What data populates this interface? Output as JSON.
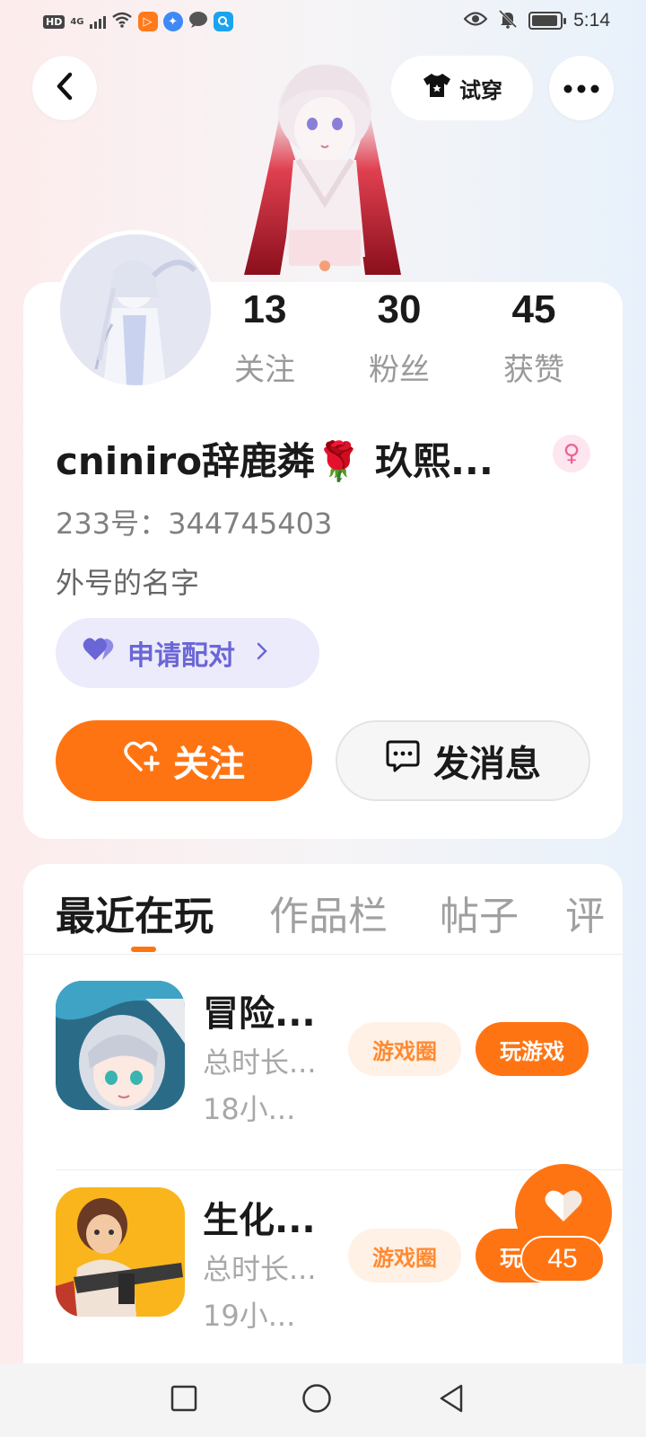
{
  "status_bar": {
    "hd": "HD",
    "network": "4G",
    "time": "5:14"
  },
  "header": {
    "back_icon": "chevron-left-icon",
    "try_on_label": "试穿",
    "try_on_icon": "shirt-icon",
    "more_icon": "more-dots-icon"
  },
  "profile": {
    "stats": [
      {
        "value": "13",
        "label": "关注"
      },
      {
        "value": "30",
        "label": "粉丝"
      },
      {
        "value": "45",
        "label": "获赞"
      }
    ],
    "username": "cniniro辞鹿粦🌹 玖熙...",
    "gender_icon": "female-icon",
    "user_id": "233号：344745403",
    "bio": "外号的名字",
    "pair_button": "申请配对",
    "follow_button": "关注",
    "message_button": "发消息"
  },
  "tabs": [
    {
      "label": "最近在玩",
      "active": true
    },
    {
      "label": "作品栏",
      "active": false
    },
    {
      "label": "帖子",
      "active": false
    },
    {
      "label": "评",
      "active": false
    }
  ],
  "games": [
    {
      "name": "冒险...",
      "meta": "总时长...",
      "hours": "18小...",
      "circle_tag": "游戏圈",
      "play_tag": "玩游戏"
    },
    {
      "name": "生化...",
      "meta": "总时长...",
      "hours": "19小...",
      "circle_tag": "游戏圈",
      "play_tag": "玩游戏"
    }
  ],
  "floating_like": {
    "count": "45",
    "icon": "heart-icon"
  },
  "colors": {
    "accent": "#ff7412",
    "pair": "#6b66d6",
    "pair_bg": "#ecebfb"
  }
}
